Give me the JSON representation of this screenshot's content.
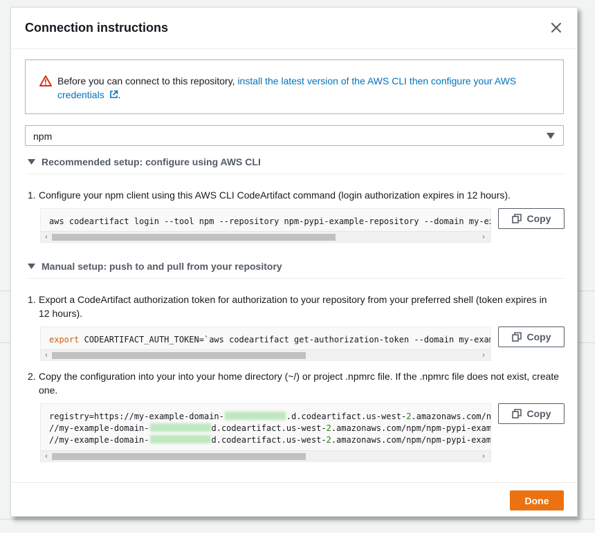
{
  "modal": {
    "title": "Connection instructions",
    "close_icon": "close-icon"
  },
  "alert": {
    "icon": "warning-icon",
    "text_before": "Before you can connect to this repository,",
    "link_text": "install the latest version of the AWS CLI then configure your AWS credentials",
    "link_icon": "external-link-icon",
    "text_after": "."
  },
  "package_manager_select": {
    "value": "npm",
    "icon": "caret-down-icon"
  },
  "recommended_setup": {
    "heading": "Recommended setup: configure using AWS CLI",
    "steps": [
      {
        "number": "1.",
        "text": "Configure your npm client using this AWS CLI CodeArtifact command (login authorization expires in 12 hours).",
        "code_lines": [
          "aws codeartifact login --tool npm --repository npm-pypi-example-repository --domain my-exam"
        ],
        "copy_label": "Copy"
      }
    ]
  },
  "manual_setup": {
    "heading": "Manual setup: push to and pull from your repository",
    "steps": [
      {
        "number": "1.",
        "text": "Export a CodeArtifact authorization token for authorization to your repository from your preferred shell (token expires in 12 hours).",
        "code_keyword": "export",
        "code_rest": " CODEARTIFACT_AUTH_TOKEN=`aws codeartifact get-authorization-token --domain my-example",
        "copy_label": "Copy"
      },
      {
        "number": "2.",
        "text": "Copy the configuration into your into your home directory (~/) or project .npmrc file. If the .npmrc file does not exist, create one.",
        "code_lines": [
          {
            "a": "registry=https://my-example-domain-",
            "b": ".d.codeartifact.us-west-",
            "n": "2",
            "c": ".amazonaws.com/npm/n"
          },
          {
            "a": "//my-example-domain-",
            "b": "d.codeartifact.us-west-",
            "n": "2",
            "c": ".amazonaws.com/npm/npm-pypi-example"
          },
          {
            "a": "//my-example-domain-",
            "b": "d.codeartifact.us-west-",
            "n": "2",
            "c": ".amazonaws.com/npm/npm-pypi-example"
          }
        ],
        "copy_label": "Copy"
      }
    ]
  },
  "footer": {
    "done_label": "Done"
  },
  "colors": {
    "accent": "#ec7211",
    "link": "#0073bb",
    "warning": "#d13212",
    "code_keyword": "#d45b07",
    "code_number": "#1d8102"
  }
}
